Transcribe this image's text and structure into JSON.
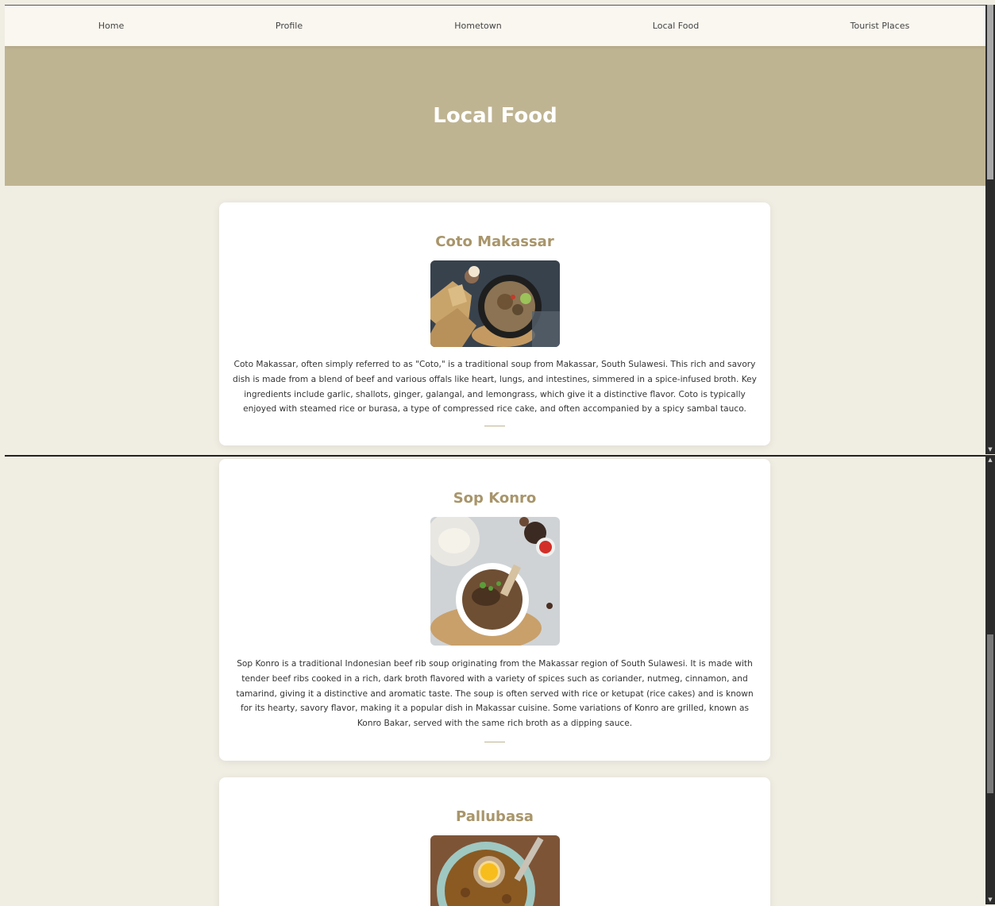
{
  "nav": {
    "items": [
      "Home",
      "Profile",
      "Hometown",
      "Local Food",
      "Tourist Places"
    ]
  },
  "hero": {
    "title": "Local Food"
  },
  "foods": [
    {
      "name": "Coto Makassar",
      "image": "coto-makassar-photo",
      "description": "Coto Makassar, often simply referred to as \"Coto,\" is a traditional soup from Makassar, South Sulawesi. This rich and savory dish is made from a blend of beef and various offals like heart, lungs, and intestines, simmered in a spice-infused broth. Key ingredients include garlic, shallots, ginger, galangal, and lemongrass, which give it a distinctive flavor. Coto is typically enjoyed with steamed rice or burasa, a type of compressed rice cake, and often accompanied by a spicy sambal tauco."
    },
    {
      "name": "Sop Konro",
      "image": "sop-konro-photo",
      "description": "Sop Konro is a traditional Indonesian beef rib soup originating from the Makassar region of South Sulawesi. It is made with tender beef ribs cooked in a rich, dark broth flavored with a variety of spices such as coriander, nutmeg, cinnamon, and tamarind, giving it a distinctive and aromatic taste. The soup is often served with rice or ketupat (rice cakes) and is known for its hearty, savory flavor, making it a popular dish in Makassar cuisine. Some variations of Konro are grilled, known as Konro Bakar, served with the same rich broth as a dipping sauce."
    },
    {
      "name": "Pallubasa",
      "image": "pallubasa-photo"
    }
  ],
  "colors": {
    "accent": "#bfb492",
    "title": "#a8956a",
    "background": "#f0ede3",
    "nav_background": "#faf7f0"
  }
}
